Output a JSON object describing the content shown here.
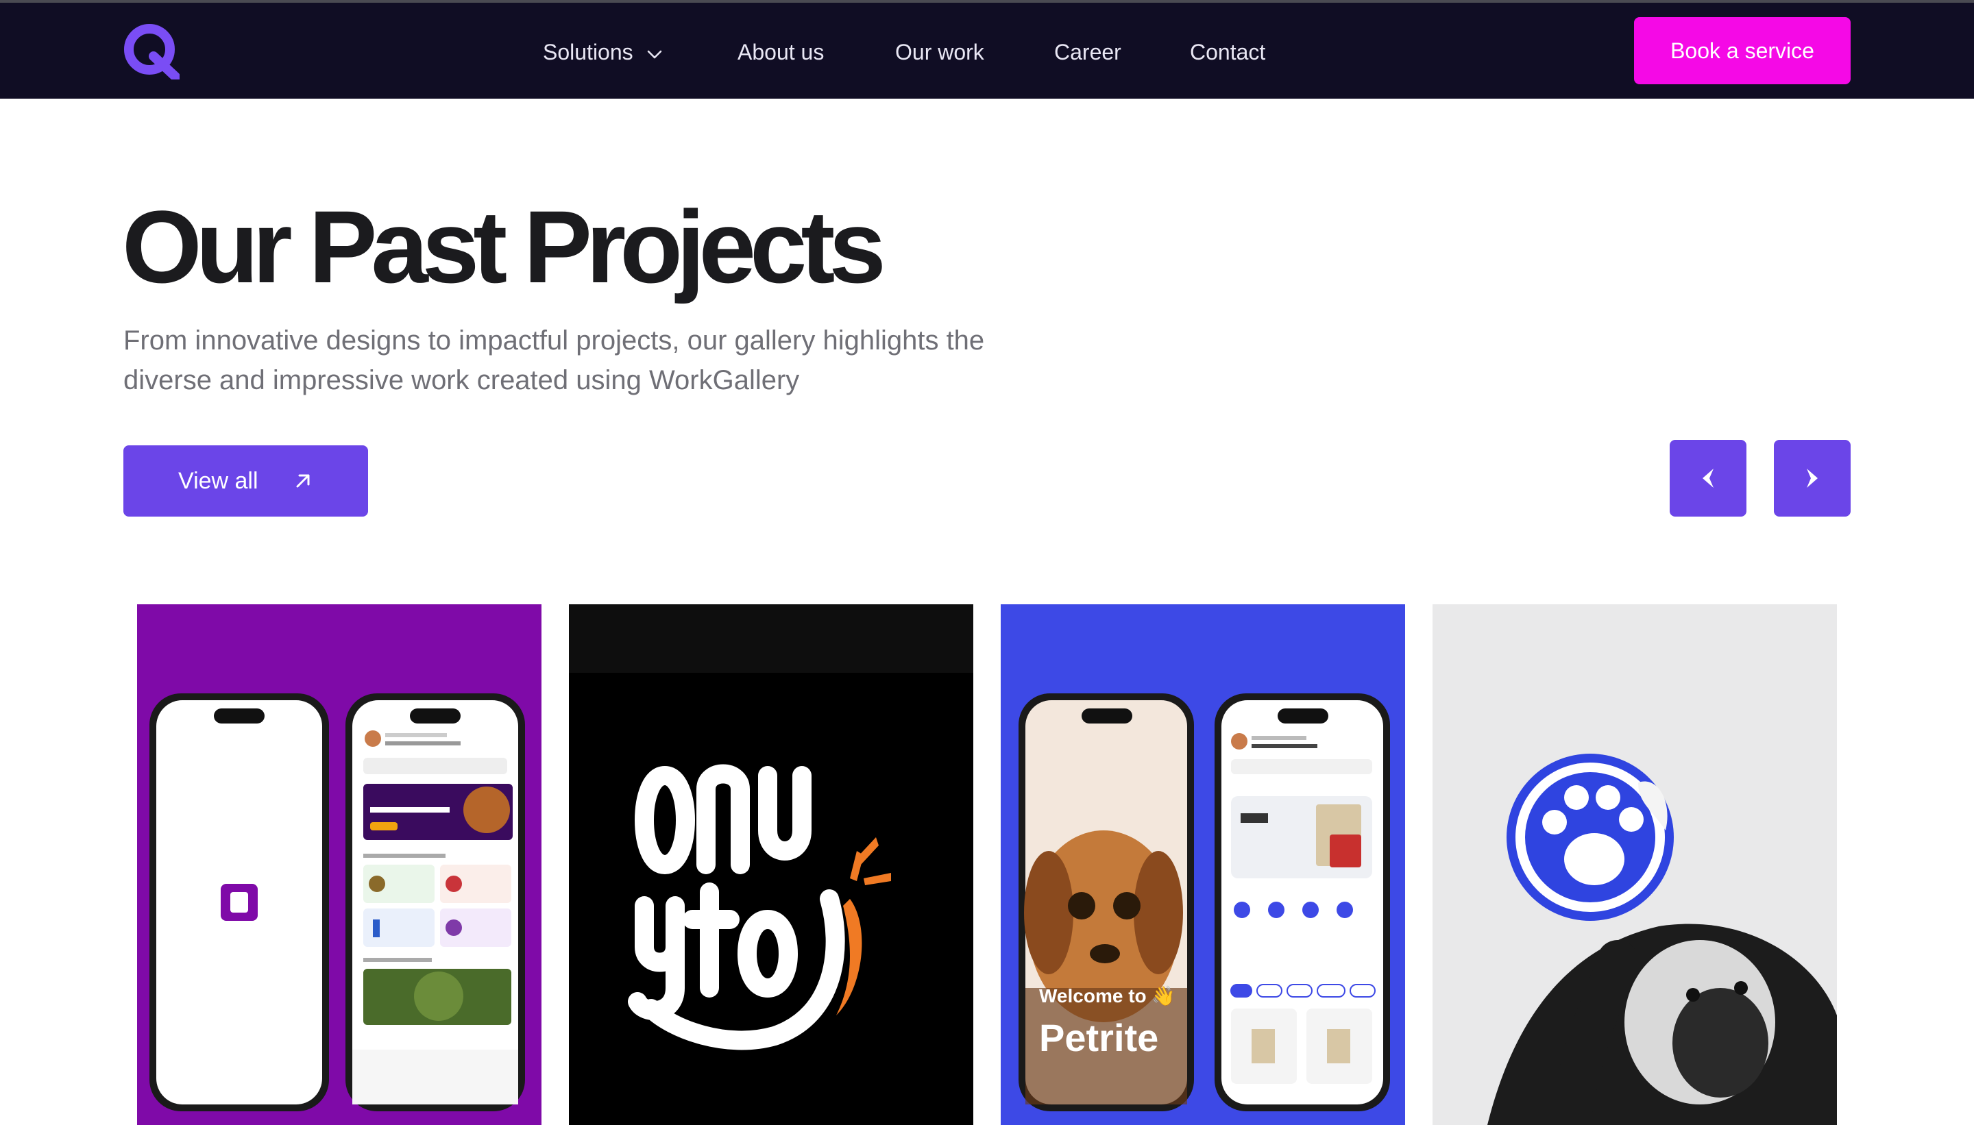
{
  "nav": {
    "logo_icon": "q-logo-icon",
    "links": [
      "Solutions",
      "About us",
      "Our work",
      "Career",
      "Contact"
    ],
    "cta": "Book a service"
  },
  "hero": {
    "title": "Our Past Projects",
    "subtitle": "From innovative designs to impactful projects, our gallery highlights the diverse and impressive work created using WorkGallery",
    "view_all": "View all"
  },
  "carousel": {
    "prev_icon": "chevron-left-icon",
    "next_icon": "chevron-right-icon"
  },
  "projects": [
    {
      "brand_color": "#7f0aa8"
    },
    {
      "brand_color": "#000000"
    },
    {
      "brand_color": "#3d49e6",
      "welcome": "Welcome to 👋",
      "name": "Petrite"
    },
    {
      "brand_color": "#e9e9ea"
    }
  ],
  "colors": {
    "nav_bg": "#100d24",
    "cta": "#f509e6",
    "accent": "#6b45e8"
  }
}
